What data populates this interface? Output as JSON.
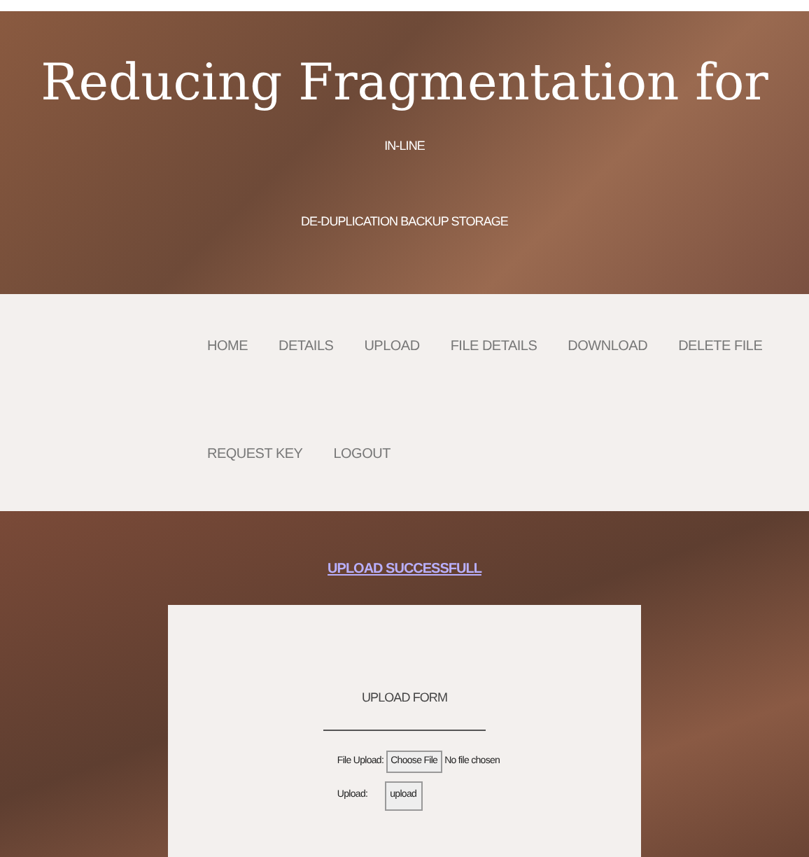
{
  "header": {
    "title": "Reducing Fragmentation for",
    "subtitle_lines": [
      "IN-LINE",
      "DE-DUPLICATION BACKUP STORAGE"
    ]
  },
  "nav": {
    "rows": [
      [
        "HOME",
        "DETAILS",
        "UPLOAD",
        "FILE DETAILS",
        "DOWNLOAD",
        "DELETE FILE"
      ],
      [
        "REQUEST KEY",
        "LOGOUT"
      ]
    ]
  },
  "message": "UPLOAD SUCCESSFULL",
  "form": {
    "title": "UPLOAD FORM",
    "file_label": "File Upload:",
    "choose_button": "Choose File",
    "file_status": "No file chosen",
    "submit_label": "Upload:",
    "submit_button": "upload"
  }
}
